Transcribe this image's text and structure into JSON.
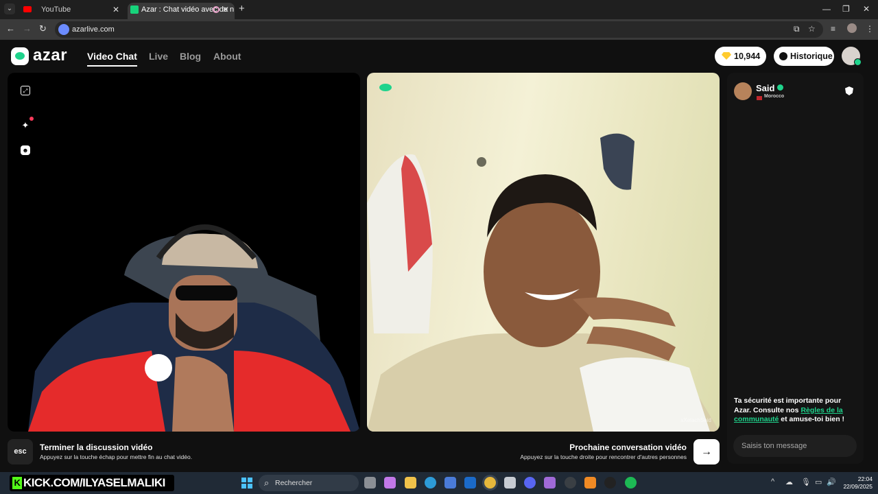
{
  "browser": {
    "tabs": [
      {
        "title": "YouTube",
        "active": false
      },
      {
        "title": "Azar : Chat vidéo avec de n",
        "active": true
      }
    ],
    "new_tab": "+",
    "url": "azarlive.com",
    "window_controls": [
      "—",
      "❐",
      "✕"
    ]
  },
  "site": {
    "logo_text": "azar",
    "nav": [
      {
        "label": "Video Chat",
        "active": true
      },
      {
        "label": "Live",
        "active": false
      },
      {
        "label": "Blog",
        "active": false
      },
      {
        "label": "About",
        "active": false
      }
    ],
    "gems": "10,944",
    "history_label": "Historique"
  },
  "peer": {
    "name": "Said",
    "country": "Morocco",
    "watermark": "xXelachSaid"
  },
  "chat": {
    "safety_prefix": "Ta sécurité est importante pour Azar. Consulte nos ",
    "safety_link": "Règles de la communauté",
    "safety_suffix": " et amuse-toi bien !",
    "input_placeholder": "Saisis ton message"
  },
  "controls": {
    "esc_label": "esc",
    "end_title": "Terminer la discussion vidéo",
    "end_subtitle": "Appuyez sur la touche échap pour mettre fin au chat vidéo.",
    "next_title": "Prochaine conversation vidéo",
    "next_subtitle": "Appuyez sur la touche droite pour rencontrer d'autres personnes",
    "next_arrow": "→"
  },
  "taskbar": {
    "overlay_text": "KICK.COM/ILYASELMALIKI",
    "search_label": "Rechercher",
    "time": "22:04",
    "date": "22/09/2025"
  },
  "colors": {
    "brand_green": "#1fd38c",
    "background": "#101010",
    "kick_green": "#53fc18"
  }
}
